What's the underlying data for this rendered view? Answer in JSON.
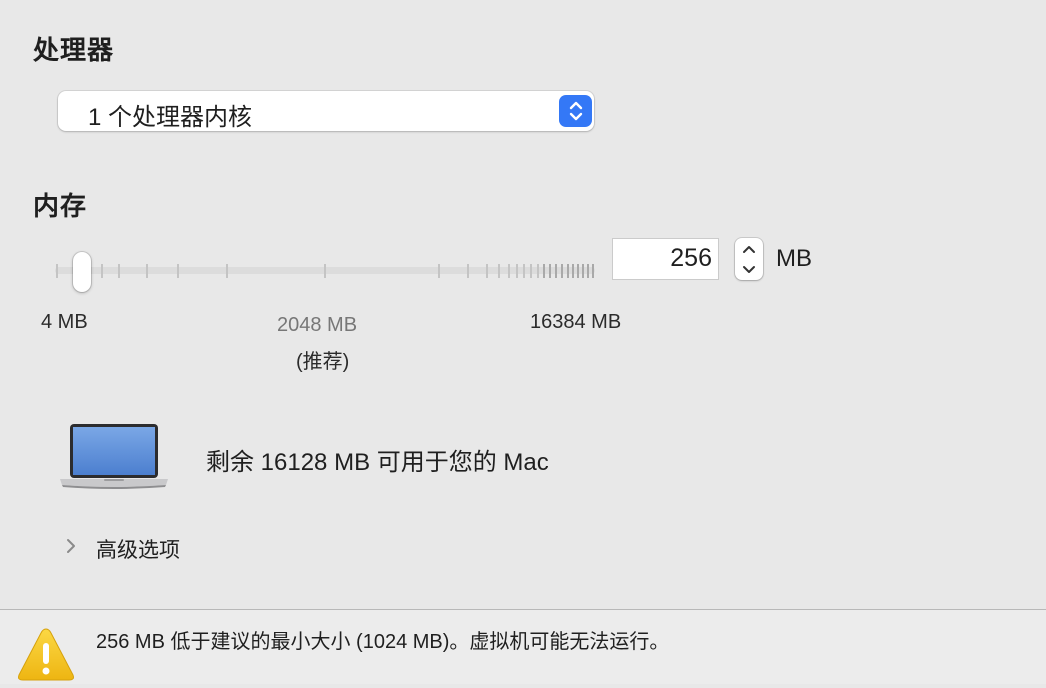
{
  "processor": {
    "title": "处理器",
    "selected": "1 个处理器内核"
  },
  "memory": {
    "title": "内存",
    "value": "256",
    "unit": "MB",
    "slider_fraction": 0.035,
    "labels": {
      "min": "4 MB",
      "recommended": "2048 MB",
      "recommended_note": "(推荐)",
      "max": "16384 MB"
    }
  },
  "host": {
    "available_text": "剩余 16128 MB 可用于您的 Mac"
  },
  "advanced": {
    "label": "高级选项"
  },
  "warning": {
    "text": "256 MB 低于建议的最小大小 (1024 MB)。虚拟机可能无法运行。"
  },
  "icons": [
    "chevron-updown-icon",
    "stepper-up-icon",
    "stepper-down-icon",
    "laptop-icon",
    "chevron-right-icon",
    "warning-icon"
  ],
  "colors": {
    "accent": "#3478f6",
    "background": "#e8e8e8",
    "warning_yellow": "#f5c518"
  }
}
